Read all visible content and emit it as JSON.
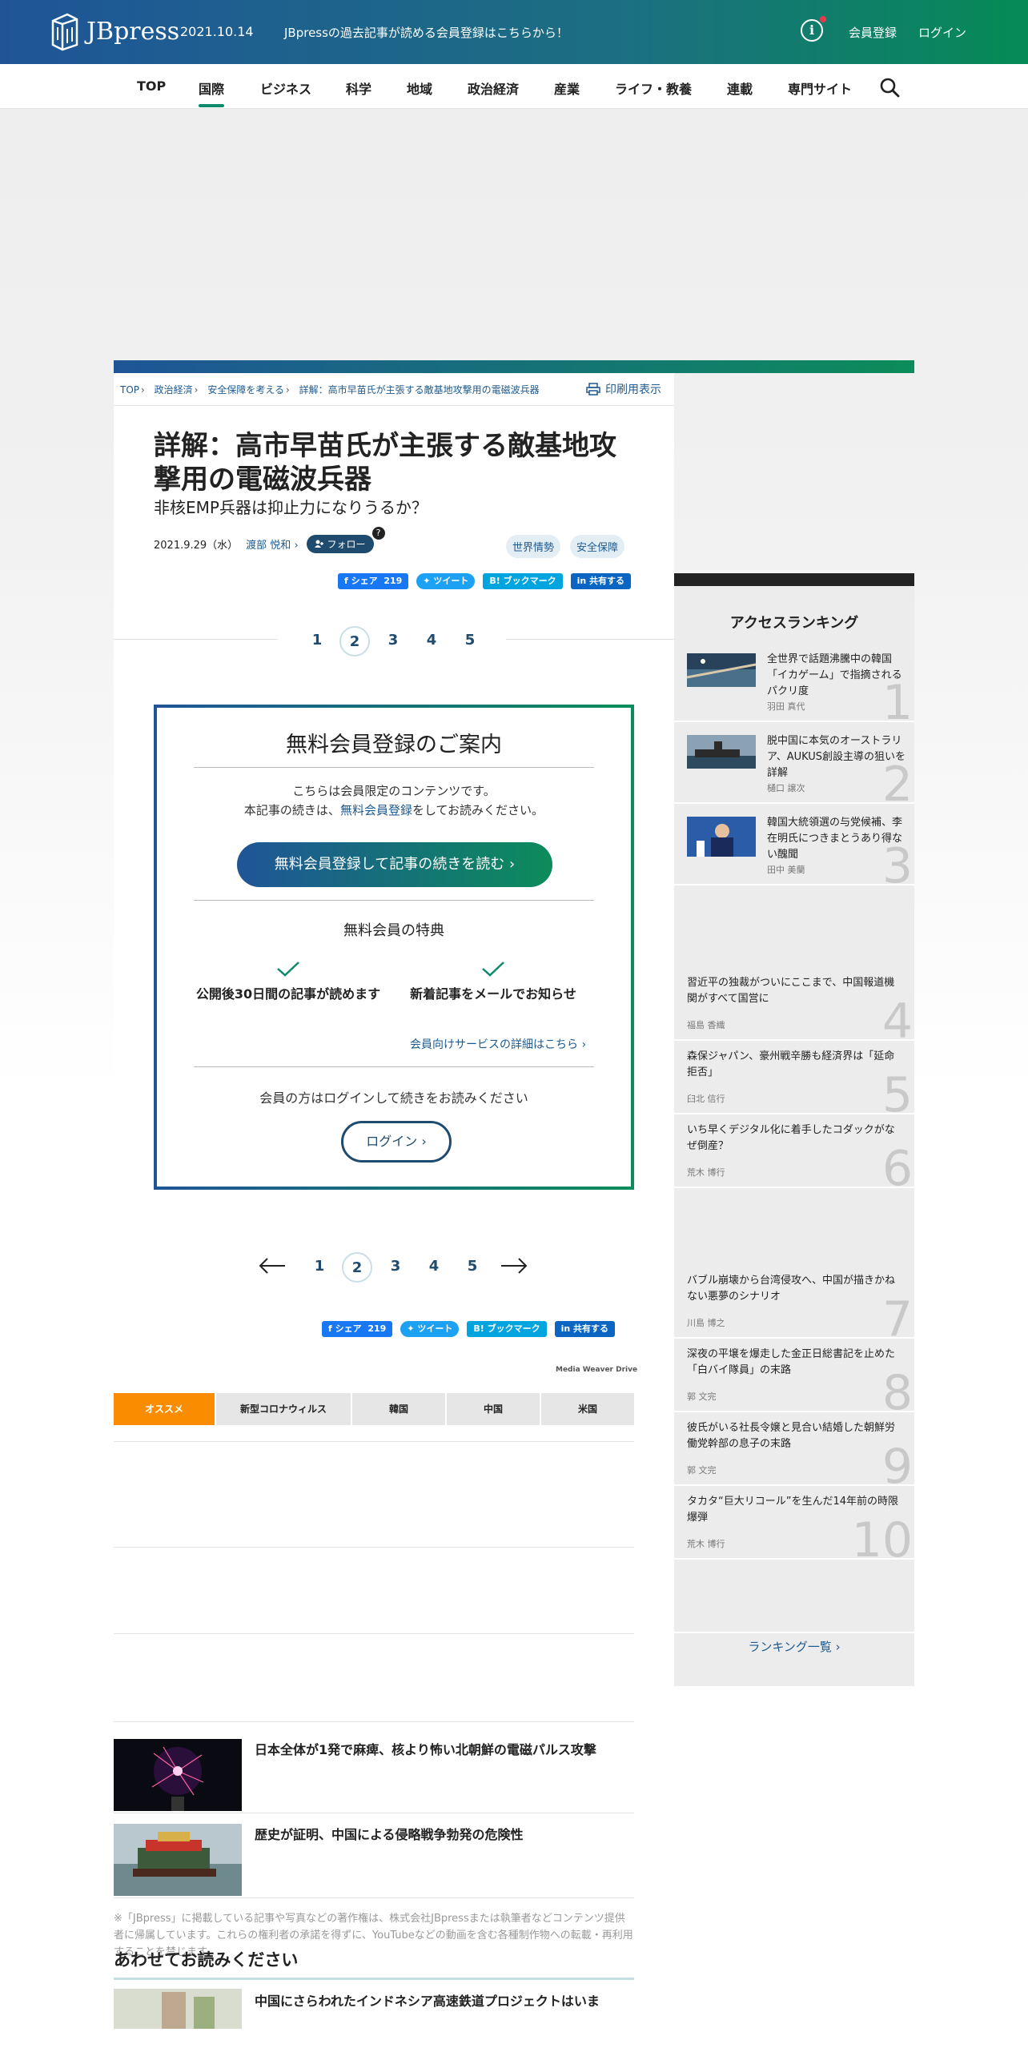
{
  "header": {
    "logo_text": "JBpress",
    "date": "2021.10.14",
    "promo": "JBpressの過去記事が読める会員登録はこちらから！",
    "register": "会員登録",
    "login": "ログイン"
  },
  "nav": {
    "items": [
      "TOP",
      "国際",
      "ビジネス",
      "科学",
      "地域",
      "政治経済",
      "産業",
      "ライフ・教養",
      "連載",
      "専門サイト"
    ],
    "active": "国際"
  },
  "breadcrumb": [
    "TOP",
    "政治経済",
    "安全保障を考える",
    "詳解：高市早苗氏が主張する敵基地攻撃用の電磁波兵器"
  ],
  "print_label": "印刷用表示",
  "article": {
    "title": "詳解：高市早苗氏が主張する敵基地攻撃用の電磁波兵器",
    "subtitle": "非核EMP兵器は抑止力になりうるか？",
    "date": "2021.9.29（水）",
    "author": "渡部 悦和",
    "follow": "フォロー",
    "follow_help": "?",
    "tags": [
      "世界情勢",
      "安全保障"
    ]
  },
  "share": {
    "facebook": "シェア",
    "facebook_count": "219",
    "tweet": "ツイート",
    "bookmark": "ブックマーク",
    "linkedin": "共有する"
  },
  "pager": {
    "pages": [
      "1",
      "2",
      "3",
      "4",
      "5"
    ],
    "current": "2"
  },
  "paywall": {
    "title": "無料会員登録のご案内",
    "text1": "こちらは会員限定のコンテンツです。",
    "text2_pre": "本記事の続きは、",
    "text2_link": "無料会員登録",
    "text2_post": "をしてお読みください。",
    "cta": "無料会員登録して記事の続きを読む ›",
    "benefits_title": "無料会員の特典",
    "benefit1": "公開後30日間の記事が読めます",
    "benefit2": "新着記事をメールでお知らせ",
    "details_link": "会員向けサービスの詳細はこちら ›",
    "login_text": "会員の方はログインして続きをお読みください",
    "login_button": "ログイン ›"
  },
  "media_weaver": "Media Weaver Drive",
  "reco_tabs": [
    "オススメ",
    "新型コロナウィルス",
    "韓国",
    "中国",
    "米国"
  ],
  "related": [
    "日本全体が1発で麻痺、核より怖い北朝鮮の電磁パルス攻撃",
    "歴史が証明、中国による侵略戦争勃発の危険性"
  ],
  "notice": "※「JBpress」に掲載している記事や写真などの著作権は、株式会社JBpressまたは執筆者などコンテンツ提供者に帰属しています。これらの権利者の承諾を得ずに、YouTubeなどの動画を含む各種制作物への転載・再利用することを禁じます。",
  "also_read": {
    "title": "あわせてお読みください",
    "first": "中国にさらわれたインドネシア高速鉄道プロジェクトはいま"
  },
  "ranking": {
    "title": "アクセスランキング",
    "items": [
      {
        "num": "1",
        "title": "全世界で話題沸騰中の韓国「イカゲーム」で指摘されるパクリ度",
        "author": "羽田 真代"
      },
      {
        "num": "2",
        "title": "脱中国に本気のオーストラリア、AUKUS創設主導の狙いを詳解",
        "author": "樋口 譲次"
      },
      {
        "num": "3",
        "title": "韓国大統領選の与党候補、李在明氏につきまとうあり得ない醜聞",
        "author": "田中 美蘭"
      },
      {
        "num": "4",
        "title": "習近平の独裁がついにここまで、中国報道機関がすべて国営に",
        "author": "福島 香織"
      },
      {
        "num": "5",
        "title": "森保ジャパン、豪州戦辛勝も経済界は「延命拒否」",
        "author": "臼北 信行"
      },
      {
        "num": "6",
        "title": "いち早くデジタル化に着手したコダックがなぜ倒産？",
        "author": "荒木 博行"
      },
      {
        "num": "7",
        "title": "バブル崩壊から台湾侵攻へ、中国が描きかねない悪夢のシナリオ",
        "author": "川島 博之"
      },
      {
        "num": "8",
        "title": "深夜の平壌を爆走した金正日総書記を止めた「白バイ隊員」の末路",
        "author": "郭 文完"
      },
      {
        "num": "9",
        "title": "彼氏がいる社長令嬢と見合い結婚した朝鮮労働党幹部の息子の末路",
        "author": "郭 文完"
      },
      {
        "num": "10",
        "title": "タカタ“巨大リコール”を生んだ14年前の時限爆弾",
        "author": "荒木 博行"
      }
    ],
    "more": "ランキング一覧 ›"
  },
  "colors": {
    "brand_blue": "#1f5597",
    "brand_green": "#058b55",
    "link": "#1d5a8f",
    "tab_active": "#fa8c00"
  }
}
